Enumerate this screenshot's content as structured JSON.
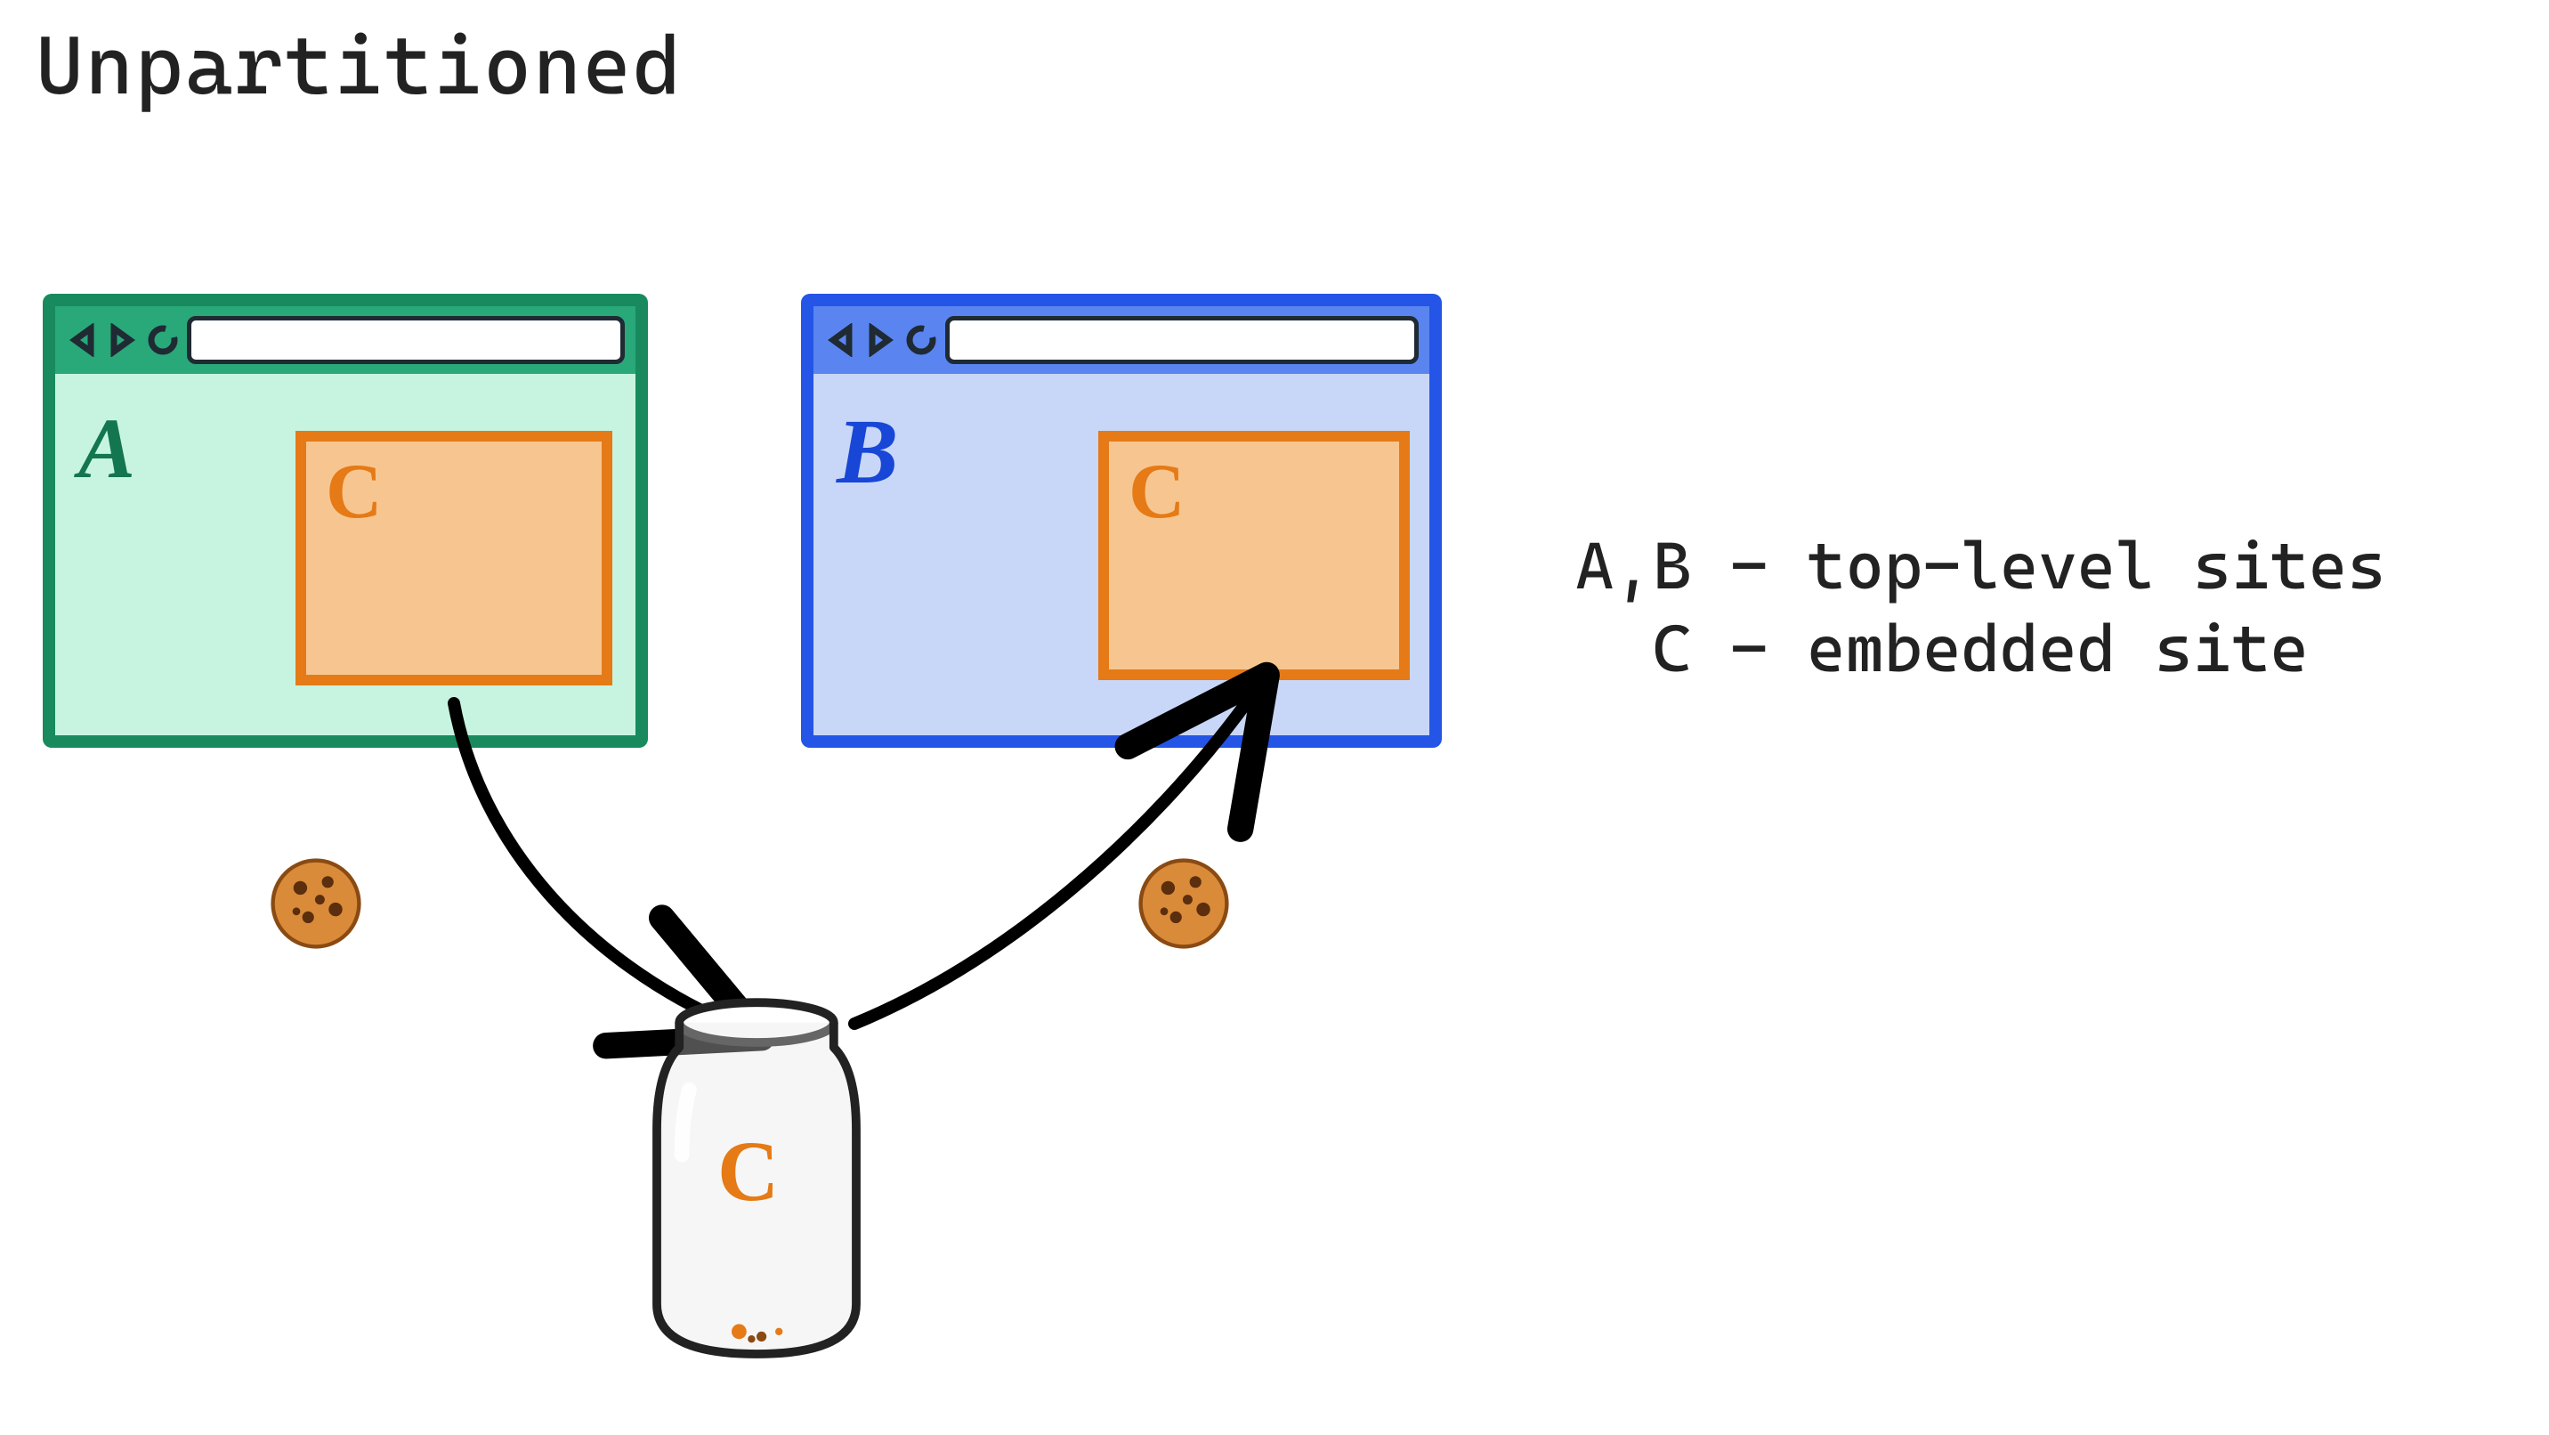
{
  "title": "Unpartitioned",
  "legend_line1": "A,B - top-level sites",
  "legend_line2": "  C - embedded site",
  "browsers": {
    "a": {
      "label": "A",
      "embedded": "C"
    },
    "b": {
      "label": "B",
      "embedded": "C"
    }
  },
  "jar": {
    "label": "C"
  },
  "colors": {
    "green_border": "#188a5e",
    "green_fill": "#c7f4e1",
    "green_toolbar": "#29a879",
    "blue_border": "#2455e6",
    "blue_fill": "#c8d7f7",
    "blue_toolbar": "#5a85f0",
    "orange": "#e57a16",
    "orange_fill": "#f7c690",
    "ink": "#1f2a33"
  },
  "icons": {
    "back": "triangle-left-icon",
    "forward": "triangle-right-icon",
    "reload": "reload-icon",
    "cookie": "cookie-icon"
  }
}
